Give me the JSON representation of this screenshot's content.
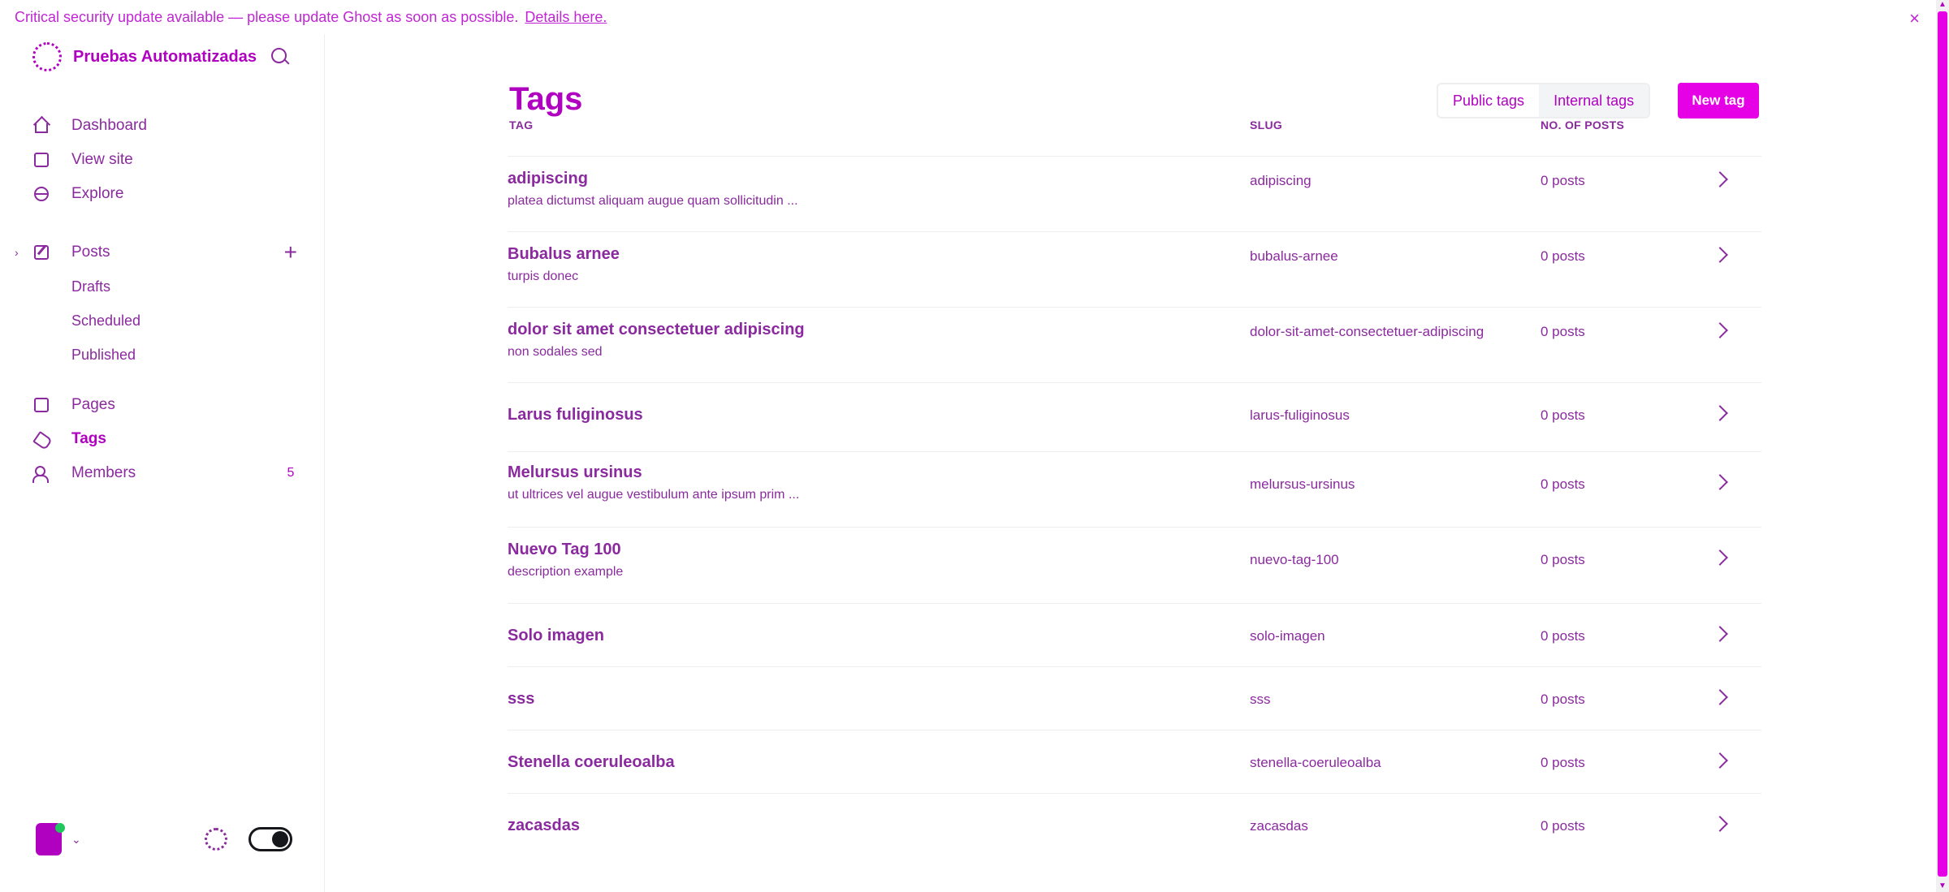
{
  "banner": {
    "text": "Critical security update available — please update Ghost as soon as possible.",
    "link": "Details here.",
    "close_icon": "×"
  },
  "sidebar": {
    "site_title": "Pruebas Automatizadas",
    "nav": [
      {
        "label": "Dashboard",
        "icon": "home-icon"
      },
      {
        "label": "View site",
        "icon": "box-icon"
      },
      {
        "label": "Explore",
        "icon": "globe-icon"
      }
    ],
    "posts": {
      "label": "Posts",
      "add_icon": "+",
      "expand_icon": "›",
      "sub_items": [
        "Drafts",
        "Scheduled",
        "Published"
      ]
    },
    "more_nav": [
      {
        "label": "Pages",
        "icon": "box-icon"
      },
      {
        "label": "Tags",
        "icon": "tag-icon"
      },
      {
        "label": "Members",
        "icon": "members-icon",
        "count": "5"
      }
    ],
    "footer": {
      "chevron": "⌄"
    }
  },
  "main": {
    "title": "Tags",
    "tabs": [
      "Public tags",
      "Internal tags"
    ],
    "new_tag_button": "New tag",
    "columns": {
      "tag": "TAG",
      "slug": "SLUG",
      "posts": "NO. OF POSTS"
    },
    "rows": [
      {
        "name": "adipiscing",
        "desc": "platea dictumst aliquam augue quam sollicitudin ...",
        "slug": "adipiscing",
        "posts": "0 posts"
      },
      {
        "name": "Bubalus arnee",
        "desc": "turpis donec",
        "slug": "bubalus-arnee",
        "posts": "0 posts"
      },
      {
        "name": "dolor sit amet consectetuer adipiscing",
        "desc": "non sodales sed",
        "slug": "dolor-sit-amet-consectetuer-adipiscing",
        "posts": "0 posts"
      },
      {
        "name": "Larus fuliginosus",
        "desc": "",
        "slug": "larus-fuliginosus",
        "posts": "0 posts"
      },
      {
        "name": "Melursus ursinus",
        "desc": "ut ultrices vel augue vestibulum ante ipsum prim ...",
        "slug": "melursus-ursinus",
        "posts": "0 posts"
      },
      {
        "name": "Nuevo Tag 100",
        "desc": "description example",
        "slug": "nuevo-tag-100",
        "posts": "0 posts"
      },
      {
        "name": "Solo imagen",
        "desc": "",
        "slug": "solo-imagen",
        "posts": "0 posts"
      },
      {
        "name": "sss",
        "desc": "",
        "slug": "sss",
        "posts": "0 posts"
      },
      {
        "name": "Stenella coeruleoalba",
        "desc": "",
        "slug": "stenella-coeruleoalba",
        "posts": "0 posts"
      },
      {
        "name": "zacasdas",
        "desc": "",
        "slug": "zacasdas",
        "posts": "0 posts"
      }
    ]
  },
  "colors": {
    "accent": "#b000c0",
    "accent_bright": "#e600e6",
    "text": "#8a2a9e",
    "border": "#eceef0"
  }
}
